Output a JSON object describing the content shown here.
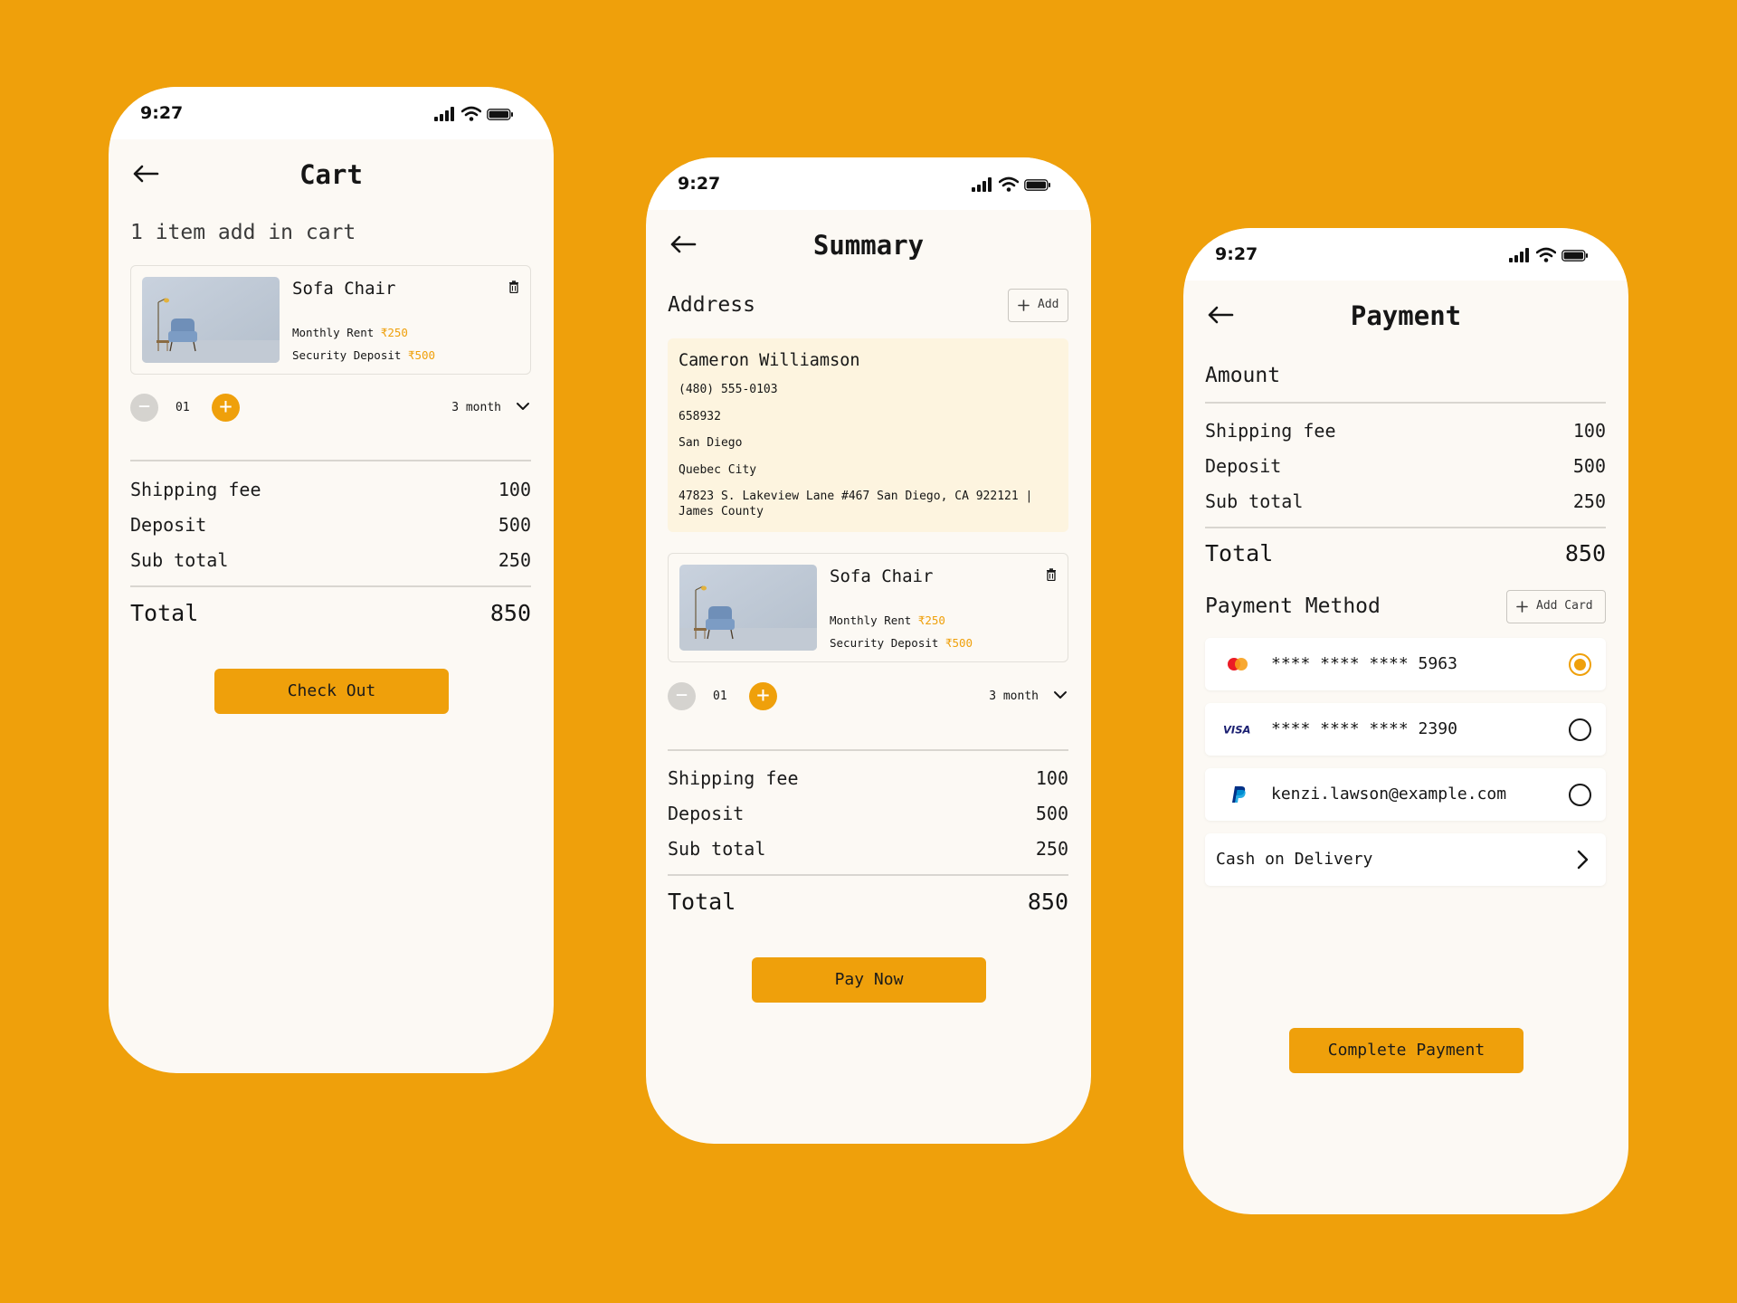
{
  "status": {
    "time": "9:27"
  },
  "cart": {
    "title": "Cart",
    "subtitle": "1 item add in cart",
    "product": {
      "name": "Sofa Chair",
      "rent_label": "Monthly Rent",
      "rent_price": "₹250",
      "deposit_label": "Security Deposit",
      "deposit_price": "₹500"
    },
    "quantity": "01",
    "duration": "3 month",
    "summary": [
      {
        "label": "Shipping fee",
        "value": "100"
      },
      {
        "label": "Deposit",
        "value": "500"
      },
      {
        "label": "Sub total",
        "value": "250"
      }
    ],
    "total": {
      "label": "Total",
      "value": "850"
    },
    "button": "Check Out"
  },
  "summary": {
    "title": "Summary",
    "address_heading": "Address",
    "add_button": "Add",
    "address": {
      "name": "Cameron Williamson",
      "phone": "(480) 555-0103",
      "zip": "658932",
      "city": "San Diego",
      "region": "Quebec City",
      "full": "47823 S. Lakeview Lane #467 San Diego, CA 922121 | James County"
    },
    "product": {
      "name": "Sofa Chair",
      "rent_label": "Monthly Rent",
      "rent_price": "₹250",
      "deposit_label": "Security Deposit",
      "deposit_price": "₹500"
    },
    "quantity": "01",
    "duration": "3 month",
    "summary": [
      {
        "label": "Shipping fee",
        "value": "100"
      },
      {
        "label": "Deposit",
        "value": "500"
      },
      {
        "label": "Sub total",
        "value": "250"
      }
    ],
    "total": {
      "label": "Total",
      "value": "850"
    },
    "button": "Pay Now"
  },
  "payment": {
    "title": "Payment",
    "amount_heading": "Amount",
    "summary": [
      {
        "label": "Shipping fee",
        "value": "100"
      },
      {
        "label": "Deposit",
        "value": "500"
      },
      {
        "label": "Sub total",
        "value": "250"
      }
    ],
    "total": {
      "label": "Total",
      "value": "850"
    },
    "method_heading": "Payment Method",
    "add_card_button": "Add Card",
    "methods": [
      {
        "icon": "mastercard-icon",
        "text": "**** **** **** 5963",
        "selected": true
      },
      {
        "icon": "visa-icon",
        "brand": "VISA",
        "text": "**** **** **** 2390",
        "selected": false
      },
      {
        "icon": "paypal-icon",
        "text": "kenzi.lawson@example.com",
        "selected": false
      }
    ],
    "cod": "Cash on Delivery",
    "button": "Complete Payment"
  },
  "colors": {
    "accent": "#EFA00B",
    "background": "#EFA00B",
    "screen": "#FCF9F4",
    "address_card": "#FDF4DF"
  }
}
